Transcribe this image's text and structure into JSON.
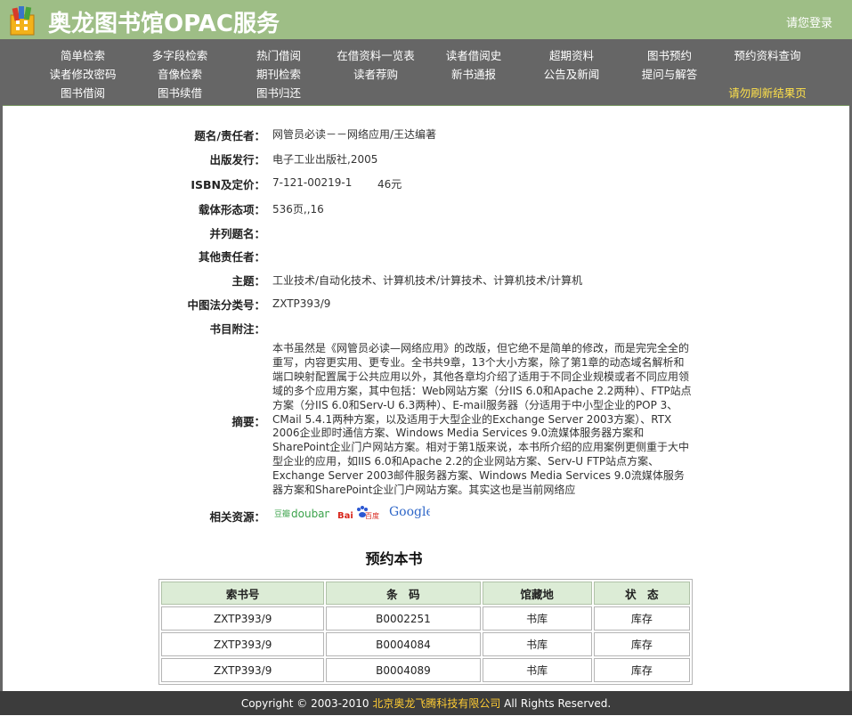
{
  "header": {
    "title": "奥龙图书馆OPAC服务",
    "login": "请您登录"
  },
  "nav": {
    "row1": [
      "简单检索",
      "多字段检索",
      "热门借阅",
      "在借资料一览表",
      "读者借阅史",
      "超期资料",
      "图书预约",
      "预约资料查询"
    ],
    "row2": [
      "读者修改密码",
      "音像检索",
      "期刊检索",
      "读者荐购",
      "新书通报",
      "公告及新闻",
      "提问与解答"
    ],
    "row3": [
      "图书借阅",
      "图书续借",
      "图书归还"
    ],
    "notice": "请勿刷新结果页"
  },
  "record": {
    "title_label": "题名/责任者：",
    "title_value": "网管员必读－－网络应用/王达编著",
    "publish_label": "出版发行：",
    "publish_value": "电子工业出版社,2005",
    "isbn_label": "ISBN及定价：",
    "isbn_value": "7-121-00219-1",
    "price_value": "46元",
    "physical_label": "载体形态项：",
    "physical_value": "536页,,16",
    "parallel_label": "并列题名：",
    "parallel_value": "",
    "other_author_label": "其他责任者：",
    "other_author_value": "",
    "subject_label": "主题：",
    "subject_value": "工业技术/自动化技术、计算机技术/计算技术、计算机技术/计算机",
    "clc_label": "中图法分类号：",
    "clc_value": "ZXTP393/9",
    "notes_label": "书目附注：",
    "notes_value": "",
    "abstract_label": "摘要：",
    "abstract_value": "本书虽然是《网管员必读—网络应用》的改版，但它绝不是简单的修改，而是完完全全的重写，内容更实用、更专业。全书共9章，13个大小方案，除了第1章的动态域名解析和端口映射配置属于公共应用以外，其他各章均介绍了适用于不同企业规模或者不同应用领域的多个应用方案，其中包括：Web网站方案（分IIS 6.0和Apache 2.2两种）、FTP站点方案（分IIS 6.0和Serv-U 6.3两种）、E-mail服务器（分适用于中小型企业的POP 3、CMail 5.4.1两种方案，以及适用于大型企业的Exchange Server 2003方案）、RTX 2006企业即时通信方案、Windows Media Services 9.0流媒体服务器方案和SharePoint企业门户网站方案。相对于第1版来说，本书所介绍的应用案例更侧重于大中型企业的应用，如IIS 6.0和Apache 2.2的企业网站方案、Serv-U FTP站点方案、Exchange Server 2003邮件服务器方案、Windows Media Services 9.0流媒体服务器方案和SharePoint企业门户网站方案。其实这也是当前网络应",
    "related_label": "相关资源：",
    "related": {
      "douban_cn": "豆瓣",
      "douban_en": "douban",
      "baidu_en": "Bai",
      "baidu_cn": "百度",
      "google": "Google"
    }
  },
  "reserve": {
    "title": "预约本书",
    "headers": [
      "索书号",
      "条　码",
      "馆藏地",
      "状　态"
    ],
    "rows": [
      [
        "ZXTP393/9",
        "B0002251",
        "书库",
        "库存"
      ],
      [
        "ZXTP393/9",
        "B0004084",
        "书库",
        "库存"
      ],
      [
        "ZXTP393/9",
        "B0004089",
        "书库",
        "库存"
      ]
    ]
  },
  "footer": {
    "prefix": "Copyright © 2003-2010 ",
    "company": "北京奥龙飞腾科技有限公司",
    "suffix": "  All Rights Reserved."
  },
  "colors": {
    "header_bg": "#9ebe86",
    "nav_bg": "#666666",
    "notice": "#ffe14a",
    "table_header_bg": "#dcecd6",
    "footer_bg": "#3c3c3c"
  }
}
